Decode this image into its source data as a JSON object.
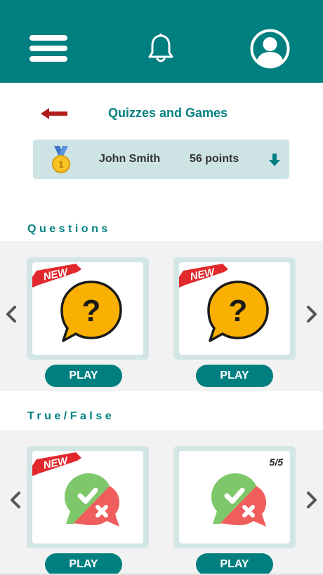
{
  "header": {
    "menu_icon": "hamburger-menu-icon",
    "notifications_icon": "bell-icon",
    "profile_icon": "user-avatar-icon",
    "background_color": "#007f80"
  },
  "page": {
    "title": "Quizzes and Games",
    "back_icon": "arrow-left-icon",
    "back_color": "#b01c1c"
  },
  "user": {
    "name": "John Smith",
    "points": "56 points",
    "medal_icon": "gold-medal-icon",
    "expand_icon": "arrow-down-icon"
  },
  "sections": {
    "questions": {
      "title": "Questions",
      "cards": [
        {
          "badge": "NEW",
          "icon": "question-bubble-icon",
          "play_label": "PLAY"
        },
        {
          "badge": "NEW",
          "icon": "question-bubble-icon",
          "play_label": "PLAY"
        }
      ]
    },
    "true_false": {
      "title": "True/False",
      "cards": [
        {
          "badge": "NEW",
          "icon": "true-false-bubble-icon",
          "play_label": "PLAY"
        },
        {
          "score": "5/5",
          "icon": "true-false-bubble-icon",
          "play_label": "PLAY"
        }
      ]
    }
  },
  "colors": {
    "accent": "#007f80",
    "question_yellow": "#f9b000",
    "true_green": "#7ec86b",
    "false_red": "#ef5d5d",
    "new_badge_red": "#e0282d"
  }
}
